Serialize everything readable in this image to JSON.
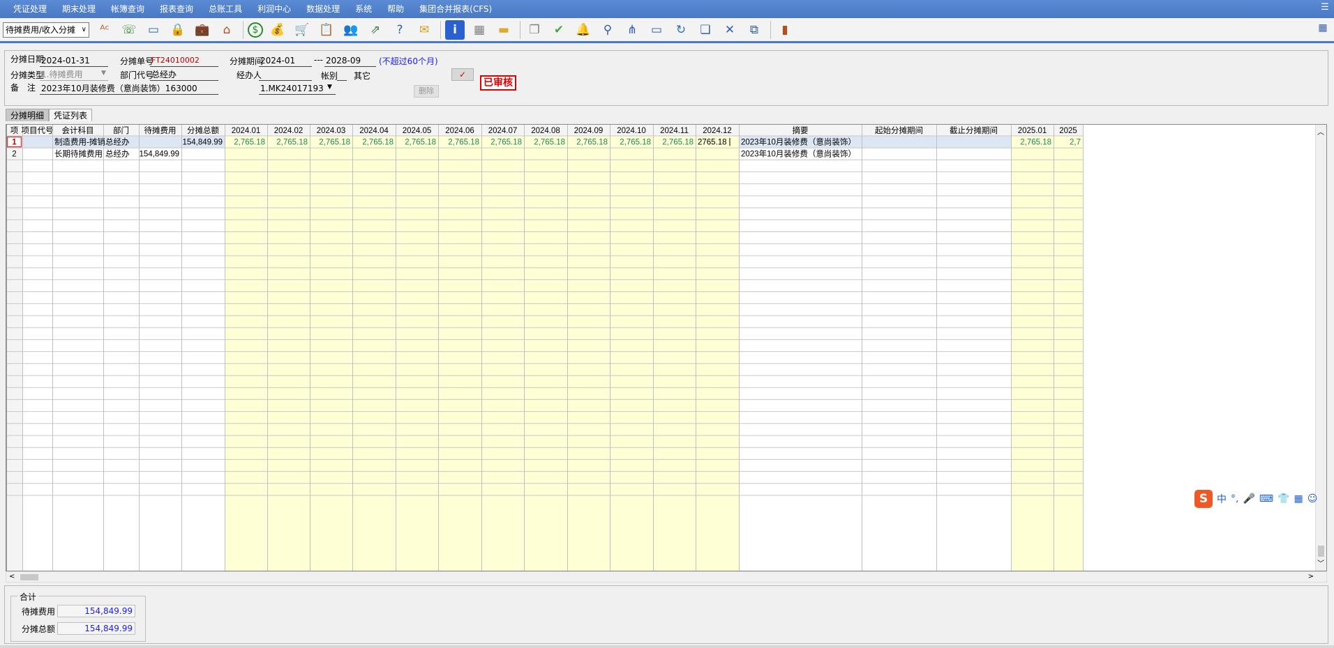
{
  "menu": [
    "凭证处理",
    "期末处理",
    "帐簿查询",
    "报表查询",
    "总账工具",
    "利润中心",
    "数据处理",
    "系统",
    "帮助",
    "集团合并报表(CFS)"
  ],
  "menu_right_icon": "list-icon",
  "toolbar": {
    "select_value": "待摊费用/收入分摊",
    "icons": [
      "spell-check-icon",
      "phone-icon",
      "monitor-icon",
      "lock-icon",
      "briefcase-icon",
      "home-icon",
      "dollar-icon",
      "money-bag-icon",
      "cart-icon",
      "clipboard-icon",
      "users-icon",
      "link-icon",
      "help-doc-icon",
      "mail-icon",
      "info-icon",
      "calculator-icon",
      "folder-icon",
      "copy-icon",
      "check-circle-icon",
      "bell-icon",
      "search-icon",
      "org-chart-icon",
      "screen-icon",
      "refresh-icon",
      "window-icon",
      "close-box-icon",
      "restore-icon",
      "exit-door-icon"
    ],
    "right_icon": "grid-settings-icon"
  },
  "header": {
    "date_label": "分摊日期",
    "date_value": "2024-01-31",
    "no_label": "分摊单号",
    "no_value": "FT24010002",
    "period_label": "分摊期间",
    "period_from": "2024-01",
    "period_sep": "---",
    "period_to": "2028-09",
    "period_note": "(不超过60个月)",
    "type_label": "分摊类型",
    "type_value": "1.待摊费用",
    "dept_label": "部门代号",
    "dept_value": "总经办",
    "handler_label": "经办人",
    "handler_value": "",
    "book_label": "帐别",
    "book_value": "",
    "other_label": "其它",
    "check_mark": "✓",
    "remark_label": "备　注",
    "remark_value": "2023年10月装修费（意尚装饰）163000",
    "voucher_value": "1.MK24017193",
    "delete_label": "删除",
    "audit_label": "已审核"
  },
  "tabs": [
    "分摊明细",
    "凭证列表"
  ],
  "grid": {
    "columns": [
      "项",
      "项目代号",
      "会计科目",
      "部门",
      "待摊费用",
      "分摊总额",
      "2024.01",
      "2024.02",
      "2024.03",
      "2024.04",
      "2024.05",
      "2024.06",
      "2024.07",
      "2024.08",
      "2024.09",
      "2024.10",
      "2024.11",
      "2024.12",
      "摘要",
      "起始分摊期间",
      "截止分摊期间",
      "2025.01",
      "2025"
    ],
    "rows": [
      [
        "1",
        "",
        "制造费用-摊销",
        "总经办",
        "",
        "154,849.99",
        "2,765.18",
        "2,765.18",
        "2,765.18",
        "2,765.18",
        "2,765.18",
        "2,765.18",
        "2,765.18",
        "2,765.18",
        "2,765.18",
        "2,765.18",
        "2,765.18",
        "2765.18",
        "2023年10月装修费（意尚装饰）",
        "",
        "",
        "2,765.18",
        "2,7"
      ],
      [
        "2",
        "",
        "长期待摊费用",
        "总经办",
        "154,849.99",
        "",
        "",
        "",
        "",
        "",
        "",
        "",
        "",
        "",
        "",
        "",
        "",
        "",
        "2023年10月装修费（意尚装饰）",
        "",
        "",
        "",
        ""
      ]
    ]
  },
  "ime": {
    "logo": "S",
    "chars": [
      "中",
      "°,",
      "🎤",
      "⌨",
      "👕",
      "▦",
      "☺"
    ]
  },
  "footer": {
    "legend": "合计",
    "pending_label": "待摊费用",
    "pending_value": "154,849.99",
    "total_label": "分摊总额",
    "total_value": "154,849.99"
  },
  "colors": {
    "menu_bg": "#4a78c4",
    "period_cell_bg": "#ffffd5",
    "amount_text": "#1a8a5a",
    "selected_row": "#dce6f5",
    "audit_red": "#e00000"
  }
}
